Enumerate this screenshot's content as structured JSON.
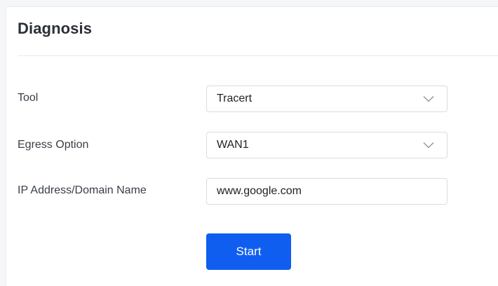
{
  "panel": {
    "title": "Diagnosis"
  },
  "form": {
    "tool": {
      "label": "Tool",
      "value": "Tracert",
      "icon": "chevron-down-icon"
    },
    "egress": {
      "label": "Egress Option",
      "value": "WAN1",
      "icon": "chevron-down-icon"
    },
    "address": {
      "label": "IP Address/Domain Name",
      "value": "www.google.com"
    },
    "start_label": "Start"
  },
  "colors": {
    "primary": "#0f5ef0",
    "border": "#d9dce1",
    "text": "#2b2f36"
  }
}
